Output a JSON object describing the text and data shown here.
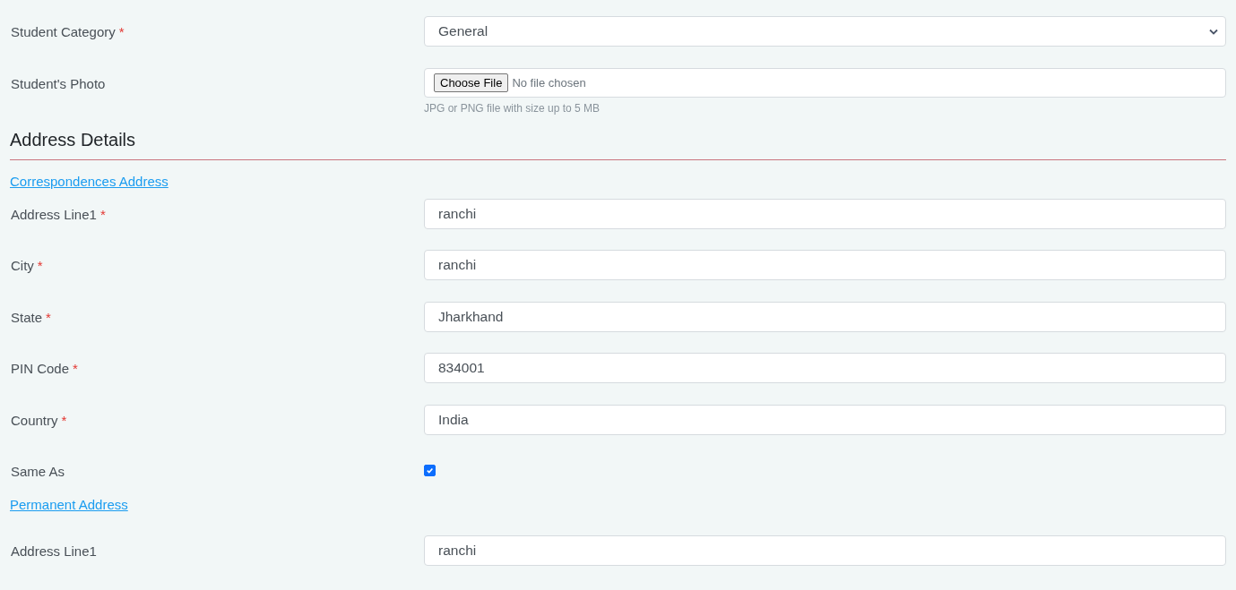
{
  "rows": [
    {
      "kind": "select",
      "label": "Student Category",
      "required_mark": "*",
      "value": "General"
    },
    {
      "kind": "file",
      "label": "Student's Photo",
      "button": "Choose File",
      "status": "No file chosen",
      "hint": "JPG or PNG file with size up to 5 MB"
    },
    {
      "kind": "heading",
      "label": "Address Details"
    },
    {
      "kind": "link",
      "label": "Correspondences Address"
    },
    {
      "kind": "text",
      "label": "Address Line1",
      "required_mark": "*",
      "value": "ranchi"
    },
    {
      "kind": "text",
      "label": "City",
      "required_mark": "*",
      "value": "ranchi"
    },
    {
      "kind": "text",
      "label": "State",
      "required_mark": "*",
      "value": "Jharkhand"
    },
    {
      "kind": "text",
      "label": "PIN Code",
      "required_mark": "*",
      "value": "834001"
    },
    {
      "kind": "text",
      "label": "Country",
      "required_mark": "*",
      "value": "India"
    },
    {
      "kind": "checkbox",
      "label": "Same As",
      "checked": true
    },
    {
      "kind": "link",
      "label": "Permanent Address"
    },
    {
      "kind": "text",
      "label": "Address Line1",
      "value": "ranchi"
    }
  ]
}
